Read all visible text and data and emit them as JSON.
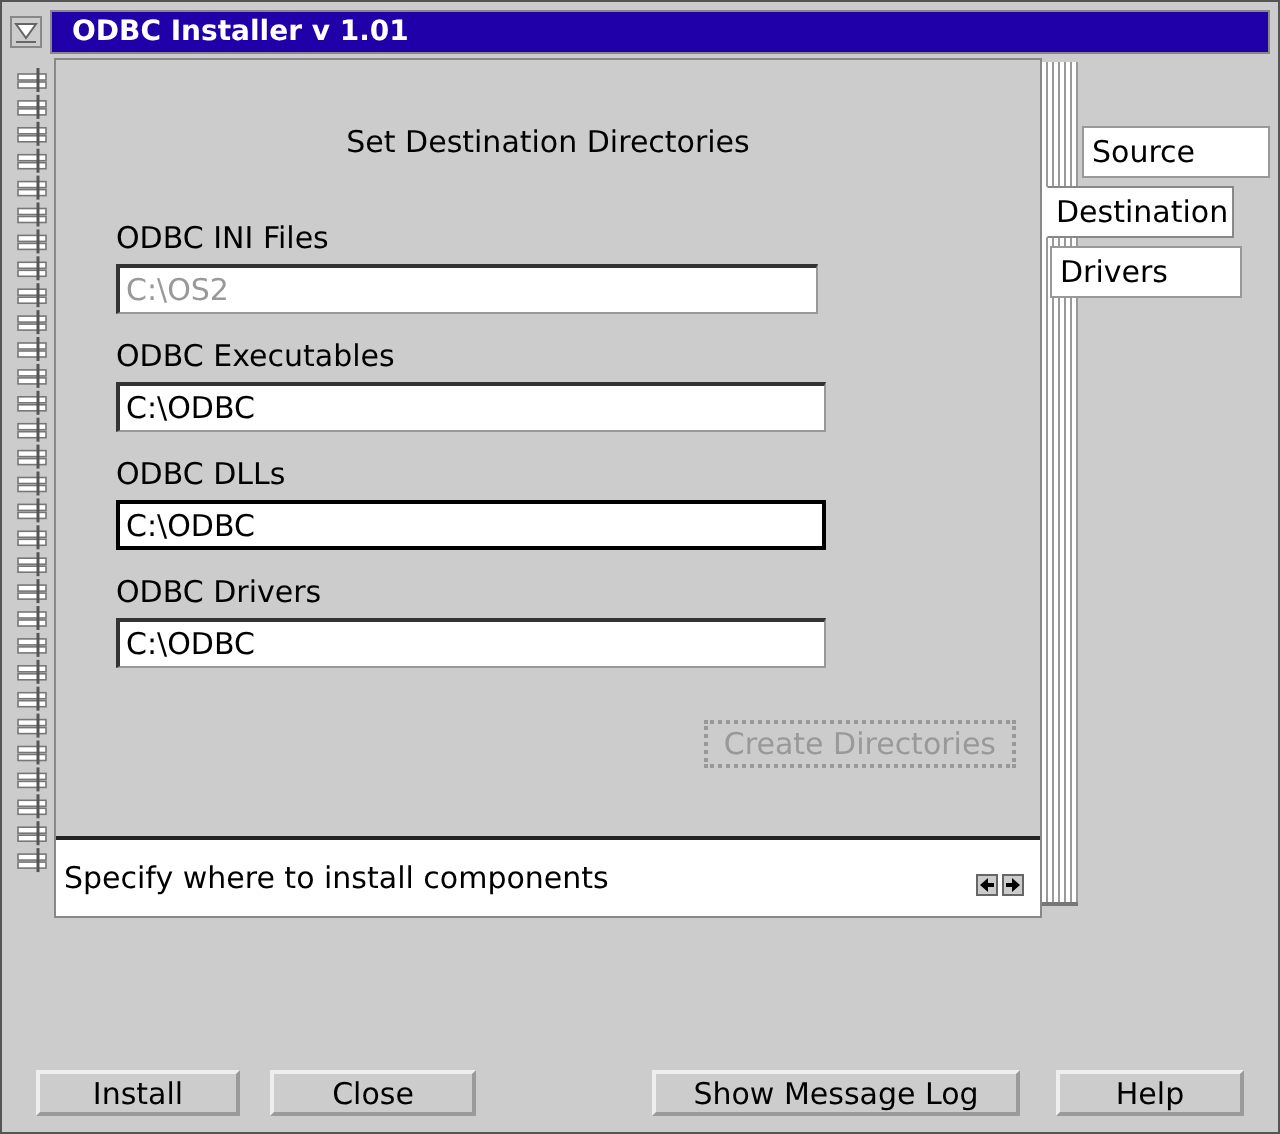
{
  "window": {
    "title": "ODBC Installer  v 1.01"
  },
  "page": {
    "heading": "Set Destination Directories",
    "fields": [
      {
        "label": "ODBC INI Files",
        "value": "C:\\OS2",
        "disabled": true,
        "focused": false
      },
      {
        "label": "ODBC Executables",
        "value": "C:\\ODBC",
        "disabled": false,
        "focused": false
      },
      {
        "label": "ODBC DLLs",
        "value": "C:\\ODBC",
        "disabled": false,
        "focused": true
      },
      {
        "label": "ODBC Drivers",
        "value": "C:\\ODBC",
        "disabled": false,
        "focused": false
      }
    ],
    "action": {
      "label": "Create Directories",
      "disabled": true
    },
    "status": "Specify where to install components"
  },
  "tabs": [
    {
      "label": "Source",
      "selected": false
    },
    {
      "label": "Destination",
      "selected": true
    },
    {
      "label": "Drivers",
      "selected": false
    }
  ],
  "buttons": [
    "Install",
    "Close",
    "Show Message Log",
    "Help"
  ]
}
